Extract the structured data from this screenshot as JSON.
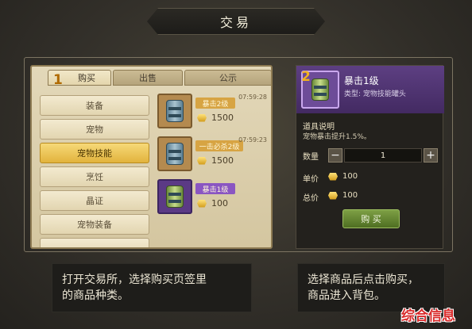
{
  "title": "交易",
  "tabs": {
    "step_number": "1",
    "buy": "购买",
    "sell": "出售",
    "public": "公示"
  },
  "categories": [
    "装备",
    "宠物",
    "宠物技能",
    "烹饪",
    "晶证",
    "宠物装备"
  ],
  "active_category": "宠物技能",
  "items": [
    {
      "name": "暴击2级",
      "time": "07:59:28",
      "price": "1500",
      "rarity": "gold"
    },
    {
      "name": "一击必杀2级",
      "time": "07:59:23",
      "price": "1500",
      "rarity": "gold"
    },
    {
      "name": "暴击1级",
      "price": "100",
      "rarity": "purple"
    }
  ],
  "detail": {
    "step_number": "2",
    "name": "暴击1级",
    "type": "类型: 宠物技能罐头",
    "desc_title": "道具说明",
    "desc_text": "宠物暴击提升1.5%。",
    "qty_label": "数量",
    "qty_value": "1",
    "minus": "−",
    "plus": "+",
    "unit_price_label": "单价",
    "unit_price": "100",
    "total_price_label": "总价",
    "total_price": "100",
    "buy_label": "购 买"
  },
  "captions": {
    "left_line1": "打开交易所，选择购买页签里",
    "left_line2": "的商品种类。",
    "right_line1": "选择商品后点击购买，",
    "right_line2": "商品进入背包。"
  },
  "watermark": "综合信息",
  "colors": {
    "gold_rarity": "#d7a443",
    "purple_rarity": "#8a56c2",
    "active_category": "#e2b33d",
    "buy_button": "#5f7f2f",
    "watermark": "#d92b2b"
  }
}
